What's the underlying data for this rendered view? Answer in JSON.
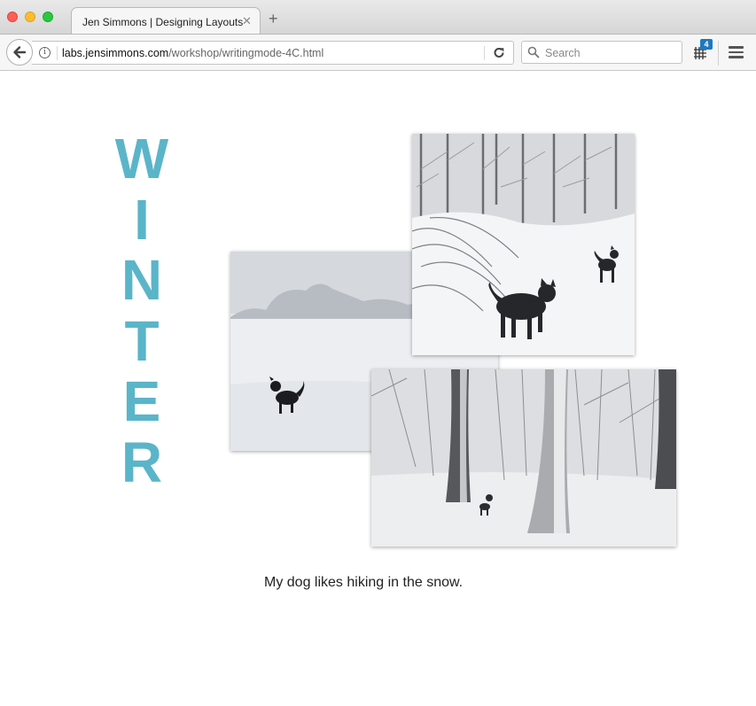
{
  "browser": {
    "tab_title": "Jen Simmons | Designing Layouts",
    "url_host": "labs.jensimmons.com",
    "url_path": "/workshop/writingmode-4C.html",
    "search_placeholder": "Search",
    "extension_badge": "4"
  },
  "page": {
    "vertical_title_letters": [
      "W",
      "I",
      "N",
      "T",
      "E",
      "R"
    ],
    "title_color": "#5ab5c9",
    "caption": "My dog likes hiking in the snow."
  }
}
